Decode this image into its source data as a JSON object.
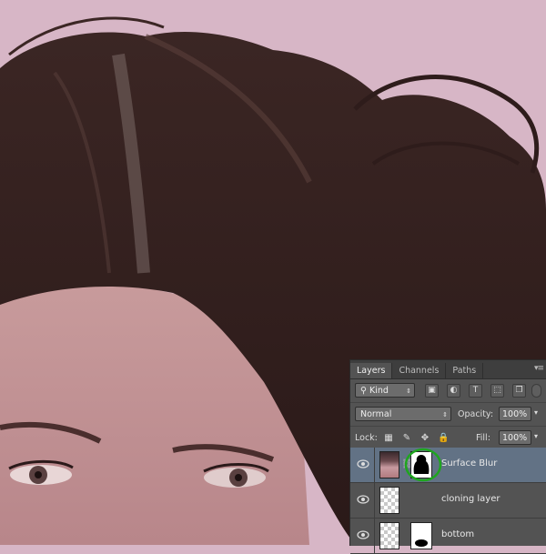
{
  "panel": {
    "tabs": [
      {
        "label": "Layers",
        "active": true
      },
      {
        "label": "Channels",
        "active": false
      },
      {
        "label": "Paths",
        "active": false
      }
    ],
    "menu_icon": "panel-menu-icon",
    "filter": {
      "kind_label": "Kind",
      "icons": [
        "image-filter-icon",
        "adjustment-filter-icon",
        "type-filter-icon",
        "shape-filter-icon",
        "smart-object-filter-icon",
        "filter-toggle-icon"
      ]
    },
    "blend": {
      "mode": "Normal",
      "opacity_label": "Opacity:",
      "opacity_value": "100%"
    },
    "lock": {
      "label": "Lock:",
      "icons": [
        "lock-transparent-icon",
        "lock-image-icon",
        "lock-position-icon",
        "lock-all-icon"
      ],
      "fill_label": "Fill:",
      "fill_value": "100%"
    },
    "layers": [
      {
        "name": "Surface Blur",
        "visible": true,
        "selected": true,
        "has_mask": true,
        "mask_circled": true
      },
      {
        "name": "cloning layer",
        "visible": true,
        "selected": false,
        "has_mask": false
      },
      {
        "name": "bottom",
        "visible": true,
        "selected": false,
        "has_mask": true
      }
    ]
  },
  "colors": {
    "background": "#d7b6c6",
    "panel": "#535353",
    "selected_layer": "#627285",
    "annotation_circle": "#1fa51f"
  }
}
